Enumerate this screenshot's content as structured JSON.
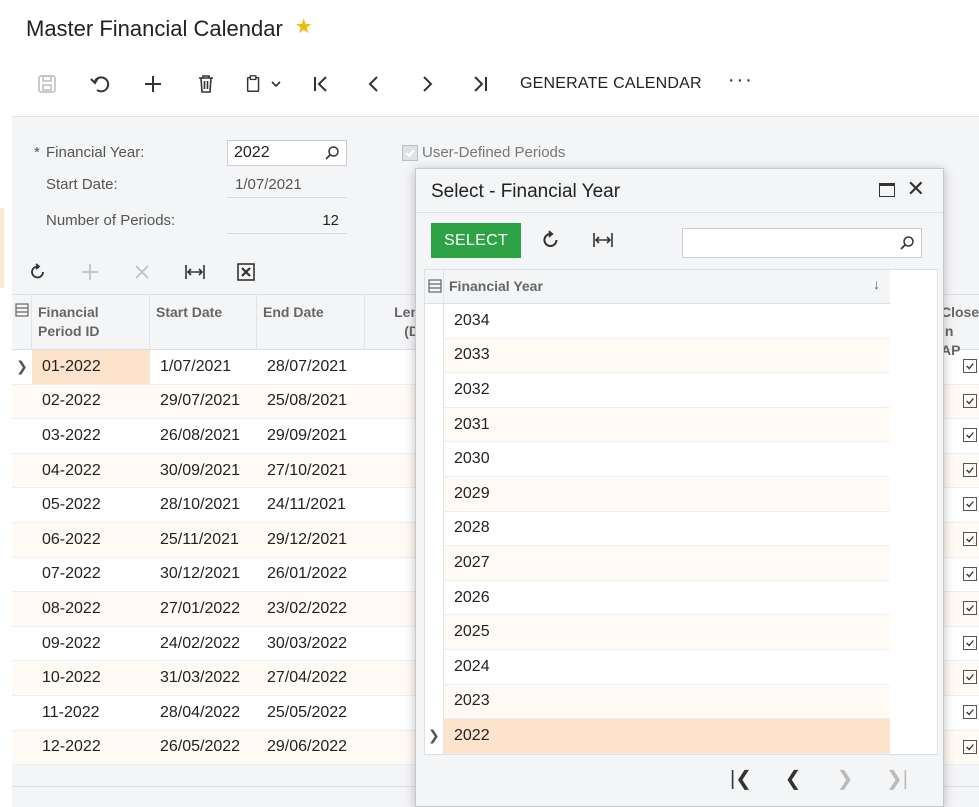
{
  "page": {
    "title": "Master Financial Calendar",
    "favorite_icon": "star-icon"
  },
  "toolbar": {
    "generate_label": "GENERATE CALENDAR",
    "more_label": "···"
  },
  "form": {
    "financial_year_label": "Financial Year:",
    "financial_year_required": "*",
    "financial_year_value": "2022",
    "start_date_label": "Start Date:",
    "start_date_value": "1/07/2021",
    "periods_label": "Number of Periods:",
    "periods_value": "12",
    "user_defined_label": "User-Defined Periods"
  },
  "grid": {
    "headers": {
      "period_id_1": "Financial",
      "period_id_2": "Period ID",
      "start_date": "Start Date",
      "end_date": "End Date",
      "length_1": "Len",
      "length_2": "(D",
      "closed_1": "Closed",
      "closed_2": "in AP"
    },
    "rows": [
      {
        "id": "01-2022",
        "start": "1/07/2021",
        "end": "28/07/2021"
      },
      {
        "id": "02-2022",
        "start": "29/07/2021",
        "end": "25/08/2021"
      },
      {
        "id": "03-2022",
        "start": "26/08/2021",
        "end": "29/09/2021"
      },
      {
        "id": "04-2022",
        "start": "30/09/2021",
        "end": "27/10/2021"
      },
      {
        "id": "05-2022",
        "start": "28/10/2021",
        "end": "24/11/2021"
      },
      {
        "id": "06-2022",
        "start": "25/11/2021",
        "end": "29/12/2021"
      },
      {
        "id": "07-2022",
        "start": "30/12/2021",
        "end": "26/01/2022"
      },
      {
        "id": "08-2022",
        "start": "27/01/2022",
        "end": "23/02/2022"
      },
      {
        "id": "09-2022",
        "start": "24/02/2022",
        "end": "30/03/2022"
      },
      {
        "id": "10-2022",
        "start": "31/03/2022",
        "end": "27/04/2022"
      },
      {
        "id": "11-2022",
        "start": "28/04/2022",
        "end": "25/05/2022"
      },
      {
        "id": "12-2022",
        "start": "26/05/2022",
        "end": "29/06/2022"
      }
    ]
  },
  "dialog": {
    "title": "Select - Financial Year",
    "select_label": "SELECT",
    "search_placeholder": "",
    "column_header": "Financial Year",
    "sort_indicator": "↓",
    "years": [
      "2034",
      "2033",
      "2032",
      "2031",
      "2030",
      "2029",
      "2028",
      "2027",
      "2026",
      "2025",
      "2024",
      "2023",
      "2022"
    ],
    "selected_year": "2022"
  },
  "colors": {
    "select_button": "#2ea345",
    "selected_row": "#fde3cc",
    "alt_row": "#fffaf4",
    "star": "#f5b800"
  }
}
